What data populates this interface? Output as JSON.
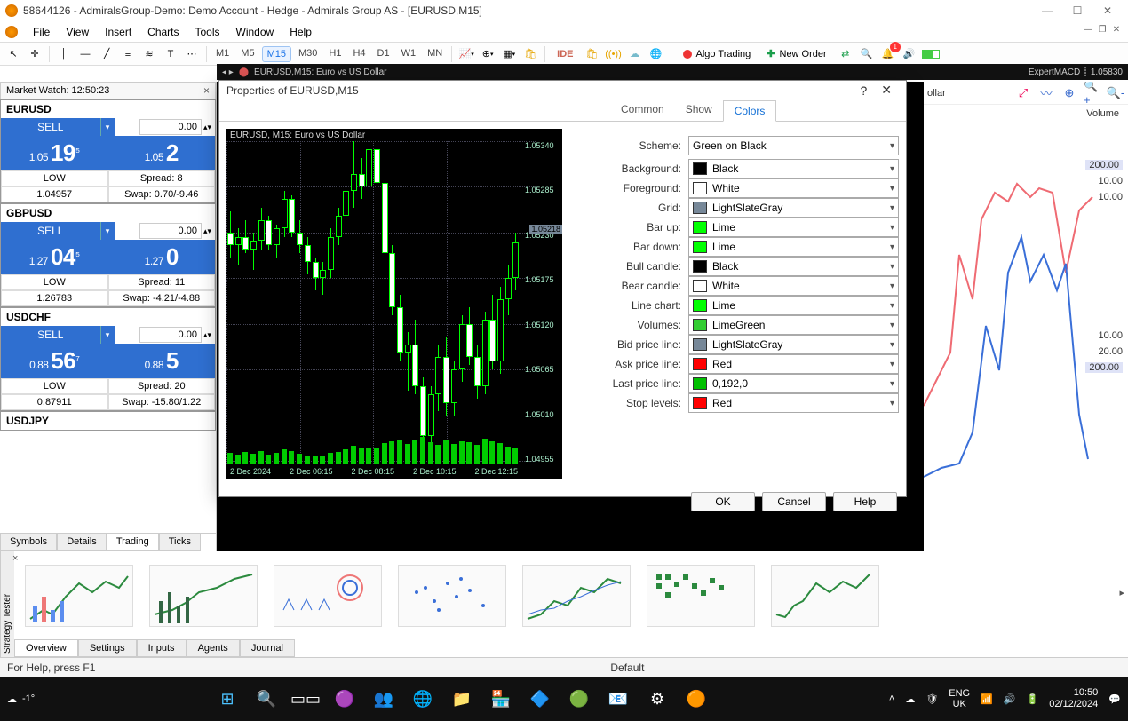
{
  "window": {
    "title": "58644126 - AdmiralsGroup-Demo: Demo Account - Hedge - Admirals Group AS - [EURUSD,M15]"
  },
  "menu": [
    "File",
    "View",
    "Insert",
    "Charts",
    "Tools",
    "Window",
    "Help"
  ],
  "timeframes": [
    "M1",
    "M5",
    "M15",
    "M30",
    "H1",
    "H4",
    "D1",
    "W1",
    "MN"
  ],
  "timeframe_selected": "M15",
  "toolbar": {
    "ide": "IDE",
    "algo": "Algo Trading",
    "neworder": "New Order",
    "notif_count": "1"
  },
  "chart_header": {
    "left": "EURUSD,M15: Euro vs US Dollar",
    "right_label": "ExpertMACD",
    "right_price": "1.05830"
  },
  "market_watch": {
    "title": "Market Watch: 12:50:23",
    "tabs": [
      "Symbols",
      "Details",
      "Trading",
      "Ticks"
    ],
    "tab_active": "Trading",
    "lots_default": "0.00",
    "blocks": [
      {
        "sym": "EURUSD",
        "sell": "SELL",
        "bid": "1.05 19⁵",
        "ask": "1.05 2",
        "low": "LOW",
        "lowv": "1.04957",
        "spread": "Spread: 8",
        "swap": "Swap: 0.70/-9.46"
      },
      {
        "sym": "GBPUSD",
        "sell": "SELL",
        "bid": "1.27 04⁵",
        "ask": "1.27 0",
        "low": "LOW",
        "lowv": "1.26783",
        "spread": "Spread: 11",
        "swap": "Swap: -4.21/-4.88"
      },
      {
        "sym": "USDCHF",
        "sell": "SELL",
        "bid": "0.88 56⁷",
        "ask": "0.88 5",
        "low": "LOW",
        "lowv": "0.87911",
        "spread": "Spread: 20",
        "swap": "Swap: -15.80/1.22"
      },
      {
        "sym": "USDJPY"
      }
    ]
  },
  "right_panel": {
    "partial_label": "ollar",
    "volume_label": "Volume",
    "rows": [
      "200.00",
      "10.00",
      "10.00"
    ],
    "rows2": [
      "10.00",
      "20.00",
      "200.00"
    ]
  },
  "dialog": {
    "title": "Properties of EURUSD,M15",
    "tabs": [
      "Common",
      "Show",
      "Colors"
    ],
    "tab_active": "Colors",
    "preview_title": "EURUSD, M15: Euro vs US Dollar",
    "scheme_label": "Scheme:",
    "scheme_value": "Green on Black",
    "rows": [
      {
        "label": "Background:",
        "value": "Black",
        "color": "#000000"
      },
      {
        "label": "Foreground:",
        "value": "White",
        "color": "#ffffff"
      },
      {
        "label": "Grid:",
        "value": "LightSlateGray",
        "color": "#778899"
      },
      {
        "label": "Bar up:",
        "value": "Lime",
        "color": "#00ff00"
      },
      {
        "label": "Bar down:",
        "value": "Lime",
        "color": "#00ff00"
      },
      {
        "label": "Bull candle:",
        "value": "Black",
        "color": "#000000"
      },
      {
        "label": "Bear candle:",
        "value": "White",
        "color": "#ffffff"
      },
      {
        "label": "Line chart:",
        "value": "Lime",
        "color": "#00ff00"
      },
      {
        "label": "Volumes:",
        "value": "LimeGreen",
        "color": "#32cd32"
      },
      {
        "label": "Bid price line:",
        "value": "LightSlateGray",
        "color": "#778899"
      },
      {
        "label": "Ask price line:",
        "value": "Red",
        "color": "#ff0000"
      },
      {
        "label": "Last price line:",
        "value": "0,192,0",
        "color": "#00c000"
      },
      {
        "label": "Stop levels:",
        "value": "Red",
        "color": "#ff0000"
      }
    ],
    "buttons": {
      "ok": "OK",
      "cancel": "Cancel",
      "help": "Help"
    },
    "yticks": [
      "1.05340",
      "1.05285",
      "1.05230",
      "1.05175",
      "1.05120",
      "1.05065",
      "1.05010",
      "1.04955"
    ],
    "current_price": "1.05218",
    "xticks": [
      "2 Dec 2024",
      "2 Dec 06:15",
      "2 Dec 08:15",
      "2 Dec 10:15",
      "2 Dec 12:15"
    ]
  },
  "tester": {
    "side_label": "Strategy Tester",
    "tabs": [
      "Overview",
      "Settings",
      "Inputs",
      "Agents",
      "Journal"
    ],
    "tab_active": "Overview"
  },
  "status_bar": {
    "left": "For Help, press F1",
    "mid": "Default"
  },
  "taskbar": {
    "temp": "-1°",
    "lang1": "ENG",
    "lang2": "UK",
    "time": "10:50",
    "date": "02/12/2024"
  },
  "chart_data": {
    "type": "candlestick",
    "title": "EURUSD, M15: Euro vs US Dollar",
    "ylim": [
      1.04955,
      1.0534
    ],
    "ylabel": "",
    "xlabel": "",
    "current_price": 1.05218,
    "yticks": [
      1.0534,
      1.05285,
      1.0523,
      1.05175,
      1.0512,
      1.05065,
      1.0501,
      1.04955
    ],
    "xticks": [
      "2 Dec 2024",
      "2 Dec 06:15",
      "2 Dec 08:15",
      "2 Dec 10:15",
      "2 Dec 12:15"
    ],
    "ohlc": [
      {
        "t": "00:00",
        "o": 1.0523,
        "h": 1.05255,
        "l": 1.052,
        "c": 1.05215
      },
      {
        "t": "00:15",
        "o": 1.05215,
        "h": 1.05235,
        "l": 1.0519,
        "c": 1.05225
      },
      {
        "t": "00:30",
        "o": 1.05225,
        "h": 1.05245,
        "l": 1.05205,
        "c": 1.0521
      },
      {
        "t": "00:45",
        "o": 1.0521,
        "h": 1.0523,
        "l": 1.05185,
        "c": 1.0522
      },
      {
        "t": "01:00",
        "o": 1.0522,
        "h": 1.0526,
        "l": 1.0521,
        "c": 1.05245
      },
      {
        "t": "01:15",
        "o": 1.05245,
        "h": 1.0525,
        "l": 1.0521,
        "c": 1.05215
      },
      {
        "t": "01:30",
        "o": 1.05215,
        "h": 1.0524,
        "l": 1.052,
        "c": 1.05235
      },
      {
        "t": "01:45",
        "o": 1.05235,
        "h": 1.0528,
        "l": 1.05225,
        "c": 1.0527
      },
      {
        "t": "02:00",
        "o": 1.0527,
        "h": 1.05275,
        "l": 1.05225,
        "c": 1.0523
      },
      {
        "t": "02:15",
        "o": 1.0523,
        "h": 1.05245,
        "l": 1.05205,
        "c": 1.05215
      },
      {
        "t": "02:30",
        "o": 1.05215,
        "h": 1.05225,
        "l": 1.0518,
        "c": 1.05195
      },
      {
        "t": "02:45",
        "o": 1.05195,
        "h": 1.052,
        "l": 1.0516,
        "c": 1.05175
      },
      {
        "t": "03:00",
        "o": 1.05175,
        "h": 1.05195,
        "l": 1.05155,
        "c": 1.05185
      },
      {
        "t": "03:15",
        "o": 1.05185,
        "h": 1.05235,
        "l": 1.05175,
        "c": 1.05225
      },
      {
        "t": "03:30",
        "o": 1.05225,
        "h": 1.0526,
        "l": 1.05215,
        "c": 1.0525
      },
      {
        "t": "03:45",
        "o": 1.0525,
        "h": 1.0529,
        "l": 1.05235,
        "c": 1.0528
      },
      {
        "t": "04:00",
        "o": 1.0528,
        "h": 1.0534,
        "l": 1.0526,
        "c": 1.053
      },
      {
        "t": "04:15",
        "o": 1.053,
        "h": 1.0532,
        "l": 1.0527,
        "c": 1.05285
      },
      {
        "t": "04:30",
        "o": 1.05285,
        "h": 1.05335,
        "l": 1.0528,
        "c": 1.0533
      },
      {
        "t": "04:45",
        "o": 1.0533,
        "h": 1.0534,
        "l": 1.0528,
        "c": 1.0529
      },
      {
        "t": "05:00",
        "o": 1.0529,
        "h": 1.053,
        "l": 1.05195,
        "c": 1.05205
      },
      {
        "t": "05:15",
        "o": 1.05205,
        "h": 1.05215,
        "l": 1.0513,
        "c": 1.0514
      },
      {
        "t": "05:30",
        "o": 1.0514,
        "h": 1.05155,
        "l": 1.05075,
        "c": 1.05085
      },
      {
        "t": "05:45",
        "o": 1.05085,
        "h": 1.0511,
        "l": 1.0504,
        "c": 1.05095
      },
      {
        "t": "06:00",
        "o": 1.05095,
        "h": 1.05125,
        "l": 1.05035,
        "c": 1.05045
      },
      {
        "t": "06:15",
        "o": 1.05045,
        "h": 1.05055,
        "l": 1.04965,
        "c": 1.04985
      },
      {
        "t": "06:30",
        "o": 1.04985,
        "h": 1.05045,
        "l": 1.0497,
        "c": 1.05035
      },
      {
        "t": "06:45",
        "o": 1.05035,
        "h": 1.05095,
        "l": 1.05015,
        "c": 1.0508
      },
      {
        "t": "07:00",
        "o": 1.0508,
        "h": 1.05105,
        "l": 1.0501,
        "c": 1.05025
      },
      {
        "t": "07:15",
        "o": 1.05025,
        "h": 1.05075,
        "l": 1.0501,
        "c": 1.05065
      },
      {
        "t": "07:30",
        "o": 1.05065,
        "h": 1.0513,
        "l": 1.0505,
        "c": 1.0512
      },
      {
        "t": "07:45",
        "o": 1.0512,
        "h": 1.0514,
        "l": 1.0507,
        "c": 1.0508
      },
      {
        "t": "08:00",
        "o": 1.0508,
        "h": 1.05095,
        "l": 1.0503,
        "c": 1.05045
      },
      {
        "t": "08:15",
        "o": 1.05045,
        "h": 1.05135,
        "l": 1.05035,
        "c": 1.05125
      },
      {
        "t": "08:30",
        "o": 1.05125,
        "h": 1.05155,
        "l": 1.05065,
        "c": 1.05075
      },
      {
        "t": "08:45",
        "o": 1.05075,
        "h": 1.05165,
        "l": 1.0506,
        "c": 1.0515
      },
      {
        "t": "09:00",
        "o": 1.0515,
        "h": 1.0519,
        "l": 1.0513,
        "c": 1.05175
      },
      {
        "t": "09:15",
        "o": 1.05175,
        "h": 1.0523,
        "l": 1.0516,
        "c": 1.05218
      }
    ],
    "volumes": [
      20,
      18,
      22,
      19,
      25,
      17,
      21,
      28,
      24,
      19,
      16,
      14,
      15,
      20,
      23,
      28,
      34,
      29,
      32,
      31,
      40,
      44,
      46,
      38,
      47,
      52,
      42,
      36,
      45,
      39,
      43,
      41,
      37,
      48,
      44,
      40,
      33,
      30
    ]
  }
}
